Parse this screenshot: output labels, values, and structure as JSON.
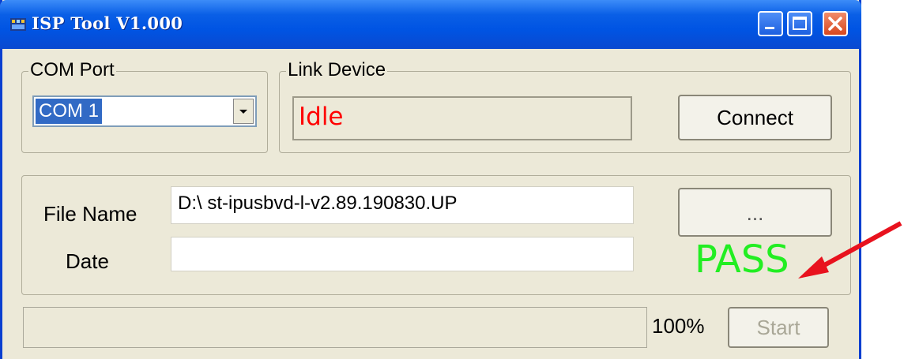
{
  "window": {
    "title": "ISP Tool V1.000"
  },
  "com_port": {
    "group_label": "COM Port",
    "selected": "COM 1"
  },
  "link_device": {
    "group_label": "Link Device",
    "status": "Idle",
    "connect_label": "Connect"
  },
  "file": {
    "name_label": "File Name",
    "name_value": "D:\\ st-ipusbvd-l-v2.89.190830.UP",
    "browse_label": "...",
    "date_label": "Date",
    "date_value": ""
  },
  "result": {
    "text": "PASS",
    "color": "#22ee22"
  },
  "footer": {
    "progress_percent": 100,
    "progress_text": "100%",
    "start_label": "Start"
  },
  "annotation": {
    "arrow_color": "#e8121e"
  }
}
